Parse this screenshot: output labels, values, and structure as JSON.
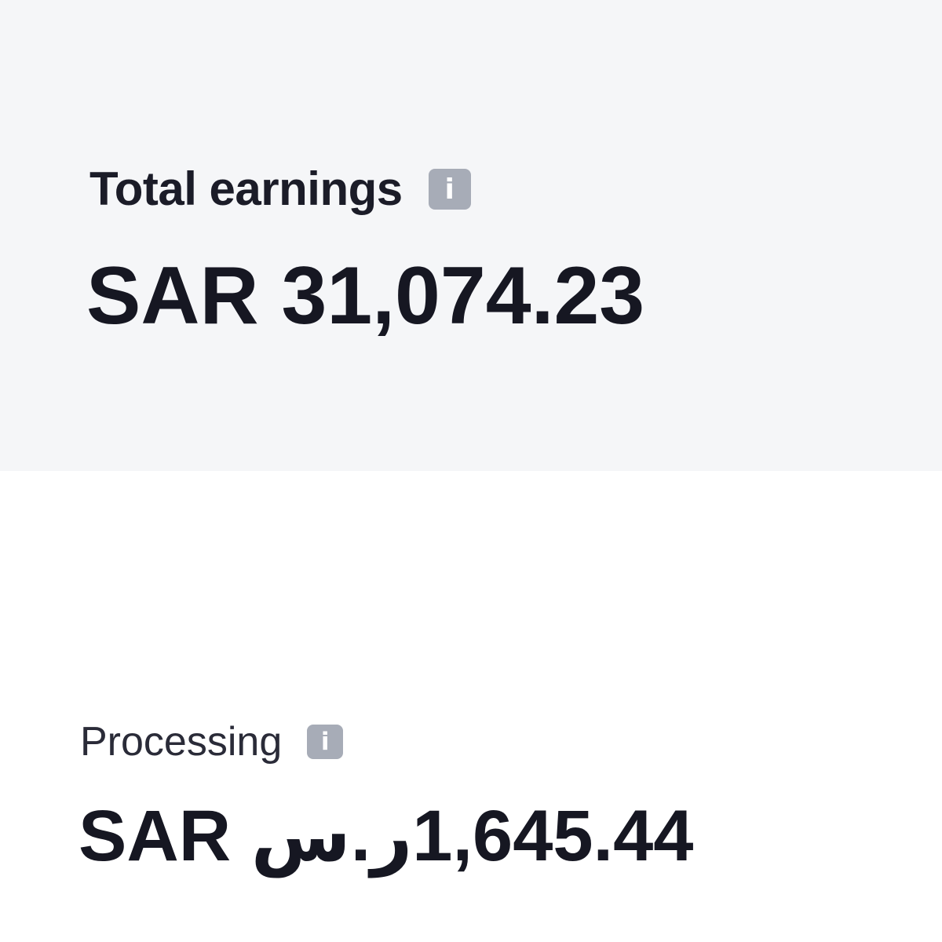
{
  "total_earnings": {
    "label": "Total earnings",
    "info_icon": "info-icon",
    "info_glyph": "i",
    "amount": "SAR 31,074.23"
  },
  "processing": {
    "label": "Processing",
    "info_icon": "info-icon",
    "info_glyph": "i",
    "amount": "1,645.44ر.س SAR"
  },
  "colors": {
    "top_panel_bg": "#f5f6f8",
    "bottom_panel_bg": "#ffffff",
    "text": "#161722",
    "info_icon_bg": "#a7acb7"
  }
}
